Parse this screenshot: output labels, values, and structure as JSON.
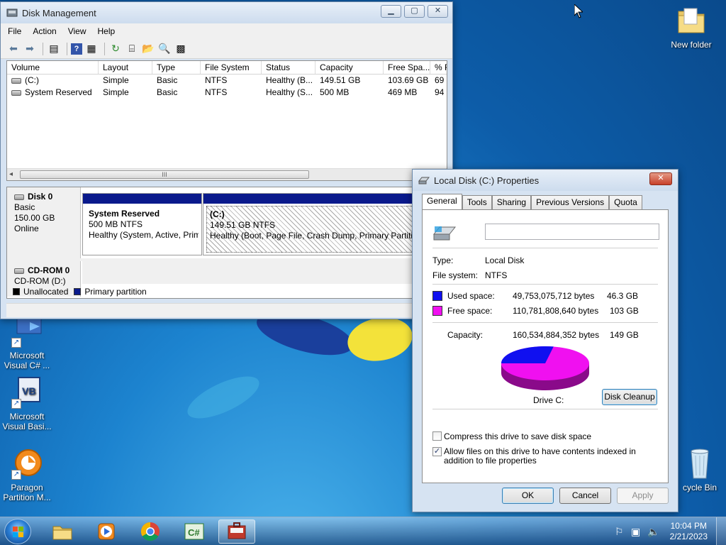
{
  "desktop": {
    "icons": [
      {
        "label": "New folder"
      },
      {
        "label": "Microsoft Visual C# ..."
      },
      {
        "label": "Microsoft Visual Basi..."
      },
      {
        "label": "Paragon Partition M..."
      },
      {
        "label": "cycle Bin"
      }
    ]
  },
  "disk_mgmt": {
    "title": "Disk Management",
    "menu": [
      "File",
      "Action",
      "View",
      "Help"
    ],
    "columns": [
      "Volume",
      "Layout",
      "Type",
      "File System",
      "Status",
      "Capacity",
      "Free Spa...",
      "% F"
    ],
    "rows": [
      [
        "(C:)",
        "Simple",
        "Basic",
        "NTFS",
        "Healthy (B...",
        "149.51 GB",
        "103.69 GB",
        "69"
      ],
      [
        "System Reserved",
        "Simple",
        "Basic",
        "NTFS",
        "Healthy (S...",
        "500 MB",
        "469 MB",
        "94"
      ]
    ],
    "scroll_grip": "III",
    "disk0": {
      "name": "Disk 0",
      "type": "Basic",
      "size": "150.00 GB",
      "state": "Online",
      "partitions": [
        {
          "name": "System Reserved",
          "size": "500 MB NTFS",
          "status": "Healthy (System, Active, Primary Partition)"
        },
        {
          "name": "(C:)",
          "size": "149.51 GB NTFS",
          "status": "Healthy (Boot, Page File, Crash Dump, Primary Partition)"
        }
      ]
    },
    "cdrom0": {
      "name": "CD-ROM 0",
      "drive": "CD-ROM (D:)"
    },
    "legend": [
      {
        "label": "Unallocated",
        "color": "#000000"
      },
      {
        "label": "Primary partition",
        "color": "#0a1a8c"
      }
    ]
  },
  "props": {
    "title": "Local Disk (C:) Properties",
    "tabs": [
      "General",
      "Tools",
      "Sharing",
      "Previous Versions",
      "Quota"
    ],
    "name_value": "",
    "type_label": "Type:",
    "type_value": "Local Disk",
    "fs_label": "File system:",
    "fs_value": "NTFS",
    "used_label": "Used space:",
    "used_bytes": "49,753,075,712 bytes",
    "used_gb": "46.3 GB",
    "used_color": "#1010f0",
    "free_label": "Free space:",
    "free_bytes": "110,781,808,640 bytes",
    "free_gb": "103 GB",
    "free_color": "#f010f0",
    "cap_label": "Capacity:",
    "cap_bytes": "160,534,884,352 bytes",
    "cap_gb": "149 GB",
    "drive_label": "Drive C:",
    "cleanup_button": "Disk Cleanup",
    "compress_label": "Compress this drive to save disk space",
    "compress_checked": false,
    "index_label": "Allow files on this drive to have contents indexed in addition to file properties",
    "index_checked": true,
    "ok": "OK",
    "cancel": "Cancel",
    "apply": "Apply"
  },
  "taskbar": {
    "time": "10:04 PM",
    "date": "2/21/2023"
  }
}
